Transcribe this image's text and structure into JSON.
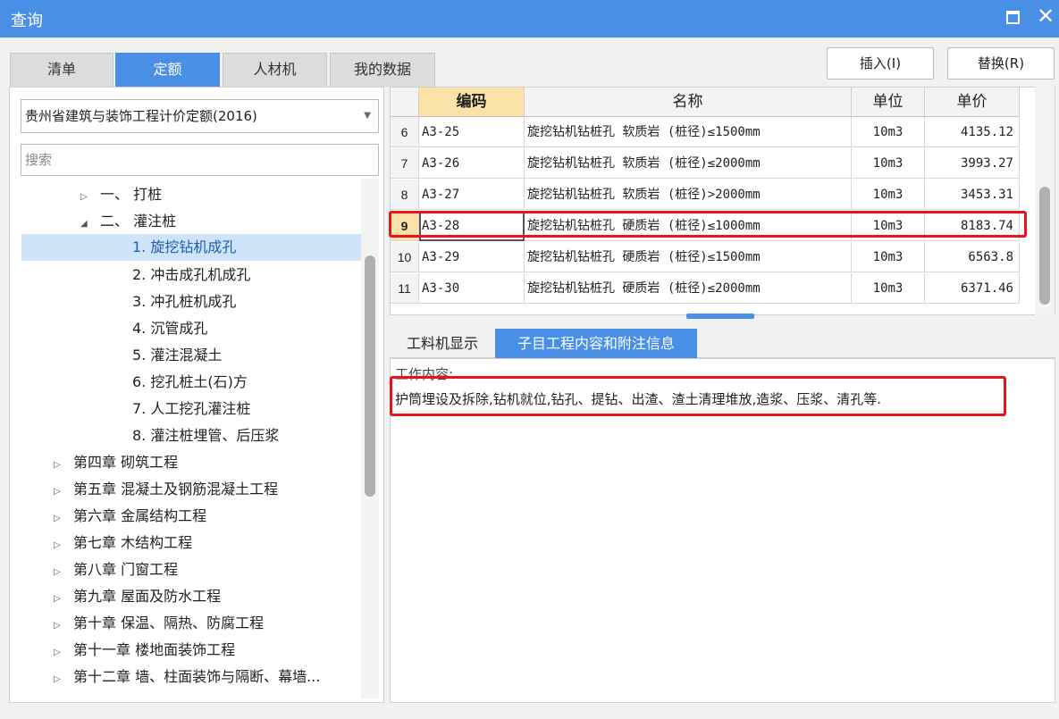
{
  "window": {
    "title": "查询"
  },
  "tabs": [
    {
      "label": "清单",
      "active": false
    },
    {
      "label": "定额",
      "active": true
    },
    {
      "label": "人材机",
      "active": false
    },
    {
      "label": "我的数据",
      "active": false
    }
  ],
  "toolbar": {
    "insert_label": "插入(I)",
    "replace_label": "替换(R)"
  },
  "left": {
    "library": "贵州省建筑与装饰工程计价定额(2016)",
    "search_placeholder": "搜索",
    "tree": [
      {
        "label": "一、 打桩",
        "arrow": "▷"
      },
      {
        "label": "二、 灌注桩",
        "arrow": "◢"
      },
      {
        "label": "1. 旋挖钻机成孔",
        "arrow": ""
      },
      {
        "label": "2. 冲击成孔机成孔",
        "arrow": ""
      },
      {
        "label": "3. 冲孔桩机成孔",
        "arrow": ""
      },
      {
        "label": "4. 沉管成孔",
        "arrow": ""
      },
      {
        "label": "5. 灌注混凝土",
        "arrow": ""
      },
      {
        "label": "6. 挖孔桩土(石)方",
        "arrow": ""
      },
      {
        "label": "7. 人工挖孔灌注桩",
        "arrow": ""
      },
      {
        "label": "8. 灌注桩埋管、后压浆",
        "arrow": ""
      },
      {
        "label": "第四章 砌筑工程",
        "arrow": "▷"
      },
      {
        "label": "第五章 混凝土及钢筋混凝土工程",
        "arrow": "▷"
      },
      {
        "label": "第六章 金属结构工程",
        "arrow": "▷"
      },
      {
        "label": "第七章 木结构工程",
        "arrow": "▷"
      },
      {
        "label": "第八章 门窗工程",
        "arrow": "▷"
      },
      {
        "label": "第九章 屋面及防水工程",
        "arrow": "▷"
      },
      {
        "label": "第十章 保温、隔热、防腐工程",
        "arrow": "▷"
      },
      {
        "label": "第十一章 楼地面装饰工程",
        "arrow": "▷"
      },
      {
        "label": "第十二章 墙、柱面装饰与隔断、幕墙...",
        "arrow": "▷"
      }
    ],
    "selected_index": 2
  },
  "grid": {
    "headers": {
      "code": "编码",
      "name": "名称",
      "unit": "单位",
      "price": "单价"
    },
    "rows": [
      {
        "num": "6",
        "code": "A3-25",
        "name": "旋挖钻机钻桩孔 软质岩 (桩径)≤1500mm",
        "unit": "10m3",
        "price": "4135.12"
      },
      {
        "num": "7",
        "code": "A3-26",
        "name": "旋挖钻机钻桩孔 软质岩 (桩径)≤2000mm",
        "unit": "10m3",
        "price": "3993.27"
      },
      {
        "num": "8",
        "code": "A3-27",
        "name": "旋挖钻机钻桩孔 软质岩 (桩径)>2000mm",
        "unit": "10m3",
        "price": "3453.31"
      },
      {
        "num": "9",
        "code": "A3-28",
        "name": "旋挖钻机钻桩孔 硬质岩 (桩径)≤1000mm",
        "unit": "10m3",
        "price": "8183.74"
      },
      {
        "num": "10",
        "code": "A3-29",
        "name": "旋挖钻机钻桩孔 硬质岩 (桩径)≤1500mm",
        "unit": "10m3",
        "price": "6563.8"
      },
      {
        "num": "11",
        "code": "A3-30",
        "name": "旋挖钻机钻桩孔 硬质岩 (桩径)≤2000mm",
        "unit": "10m3",
        "price": "6371.46"
      }
    ],
    "selected_row": 3
  },
  "subtabs": [
    {
      "label": "工料机显示",
      "active": false
    },
    {
      "label": "子目工程内容和附注信息",
      "active": true
    }
  ],
  "info": {
    "label": "工作内容:",
    "text": "护筒埋设及拆除,钻机就位,钻孔、提钻、出渣、渣土清理堆放,造浆、压浆、清孔等."
  },
  "colors": {
    "accent": "#4a8fe6",
    "highlight": "#e8141c",
    "header_code": "#fbe2a8"
  }
}
